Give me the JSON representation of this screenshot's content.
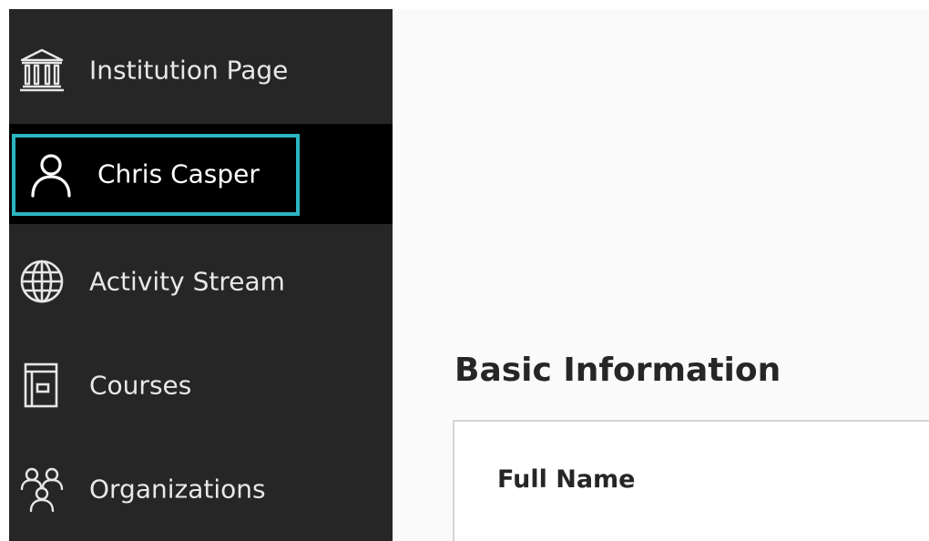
{
  "sidebar": {
    "items": [
      {
        "label": "Institution Page",
        "icon": "institution-icon"
      },
      {
        "label": "Chris Casper",
        "icon": "user-icon",
        "selected": true
      },
      {
        "label": "Activity Stream",
        "icon": "globe-icon"
      },
      {
        "label": "Courses",
        "icon": "courses-icon"
      },
      {
        "label": "Organizations",
        "icon": "organizations-icon"
      }
    ],
    "background_color": "#262626",
    "selected_background_color": "#000000",
    "focus_color": "#2bb5c2"
  },
  "main": {
    "section_title": "Basic Information",
    "fields": [
      {
        "label": "Full Name"
      }
    ]
  }
}
